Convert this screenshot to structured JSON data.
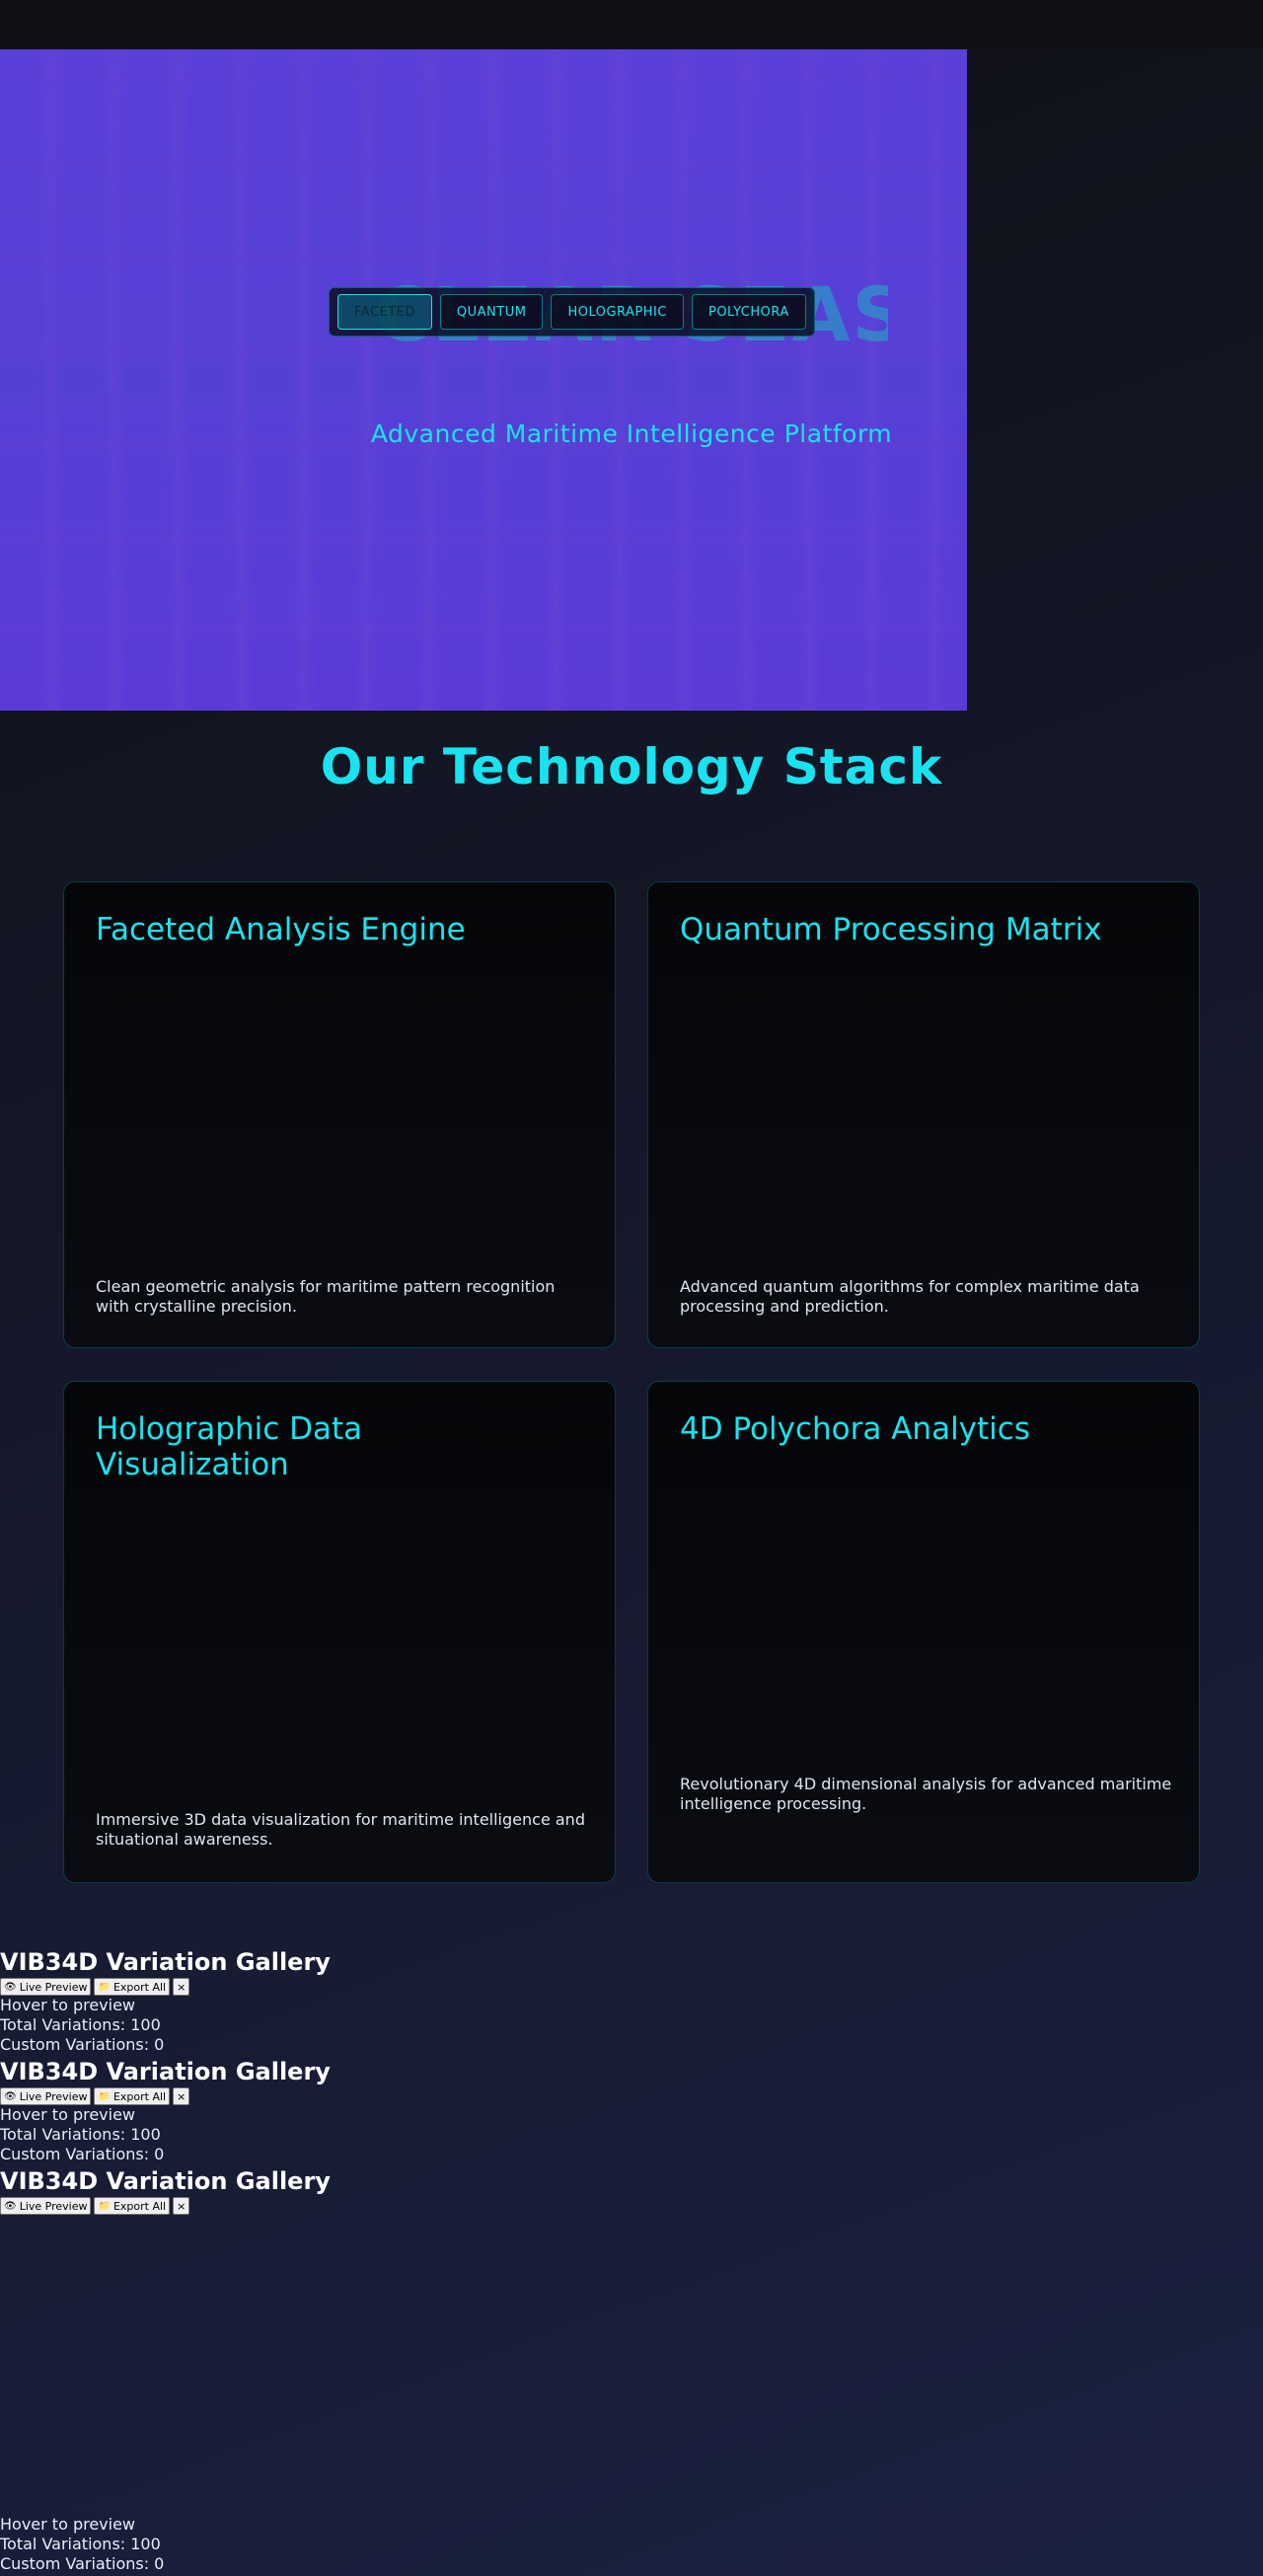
{
  "hero": {
    "title": "CLEAR SEAS",
    "modes": [
      {
        "label": "FACETED",
        "active": true
      },
      {
        "label": "QUANTUM",
        "active": false
      },
      {
        "label": "HOLOGRAPHIC",
        "active": false
      },
      {
        "label": "POLYCHORA",
        "active": false
      }
    ],
    "subtitle": "Advanced Maritime Intelligence Platform"
  },
  "tech": {
    "heading": "Our Technology Stack",
    "cards": [
      {
        "title": "Faceted Analysis Engine",
        "description": "Clean geometric analysis for maritime pattern recognition with crystalline precision."
      },
      {
        "title": "Quantum Processing Matrix",
        "description": "Advanced quantum algorithms for complex maritime data processing and prediction."
      },
      {
        "title": "Holographic Data Visualization",
        "description": "Immersive 3D data visualization for maritime intelligence and situational awareness."
      },
      {
        "title": "4D Polychora Analytics",
        "description": "Revolutionary 4D dimensional analysis for advanced maritime intelligence processing."
      }
    ]
  },
  "galleries": [
    {
      "title": "VIB34D Variation Gallery",
      "live_preview": "Live Preview",
      "export_all": "Export All",
      "close": "×",
      "hover_hint": "Hover to preview",
      "total": "Total Variations: 100",
      "custom": "Custom Variations: 0"
    },
    {
      "title": "VIB34D Variation Gallery",
      "live_preview": "Live Preview",
      "export_all": "Export All",
      "close": "×",
      "hover_hint": "Hover to preview",
      "total": "Total Variations: 100",
      "custom": "Custom Variations: 0"
    },
    {
      "title": "VIB34D Variation Gallery",
      "live_preview": "Live Preview",
      "export_all": "Export All",
      "close": "×",
      "hover_hint": "Hover to preview",
      "total": "Total Variations: 100",
      "custom": "Custom Variations: 0"
    }
  ],
  "icons": {
    "live_preview": "eye-icon",
    "export_all": "folder-icon"
  },
  "colors": {
    "accent": "#19e3f0",
    "hero_bg": "#5540d6",
    "card_bg": "#050608"
  }
}
